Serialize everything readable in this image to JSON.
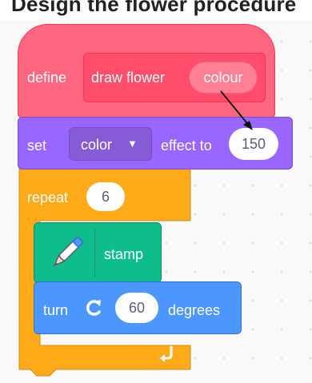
{
  "page_header_text": "Design the flower procedure",
  "define_block": {
    "keyword": "define",
    "procedure_name": "draw flower",
    "parameter": "colour"
  },
  "set_effect_block": {
    "keyword": "set",
    "effect": "color",
    "label": "effect to",
    "value": "150"
  },
  "repeat_block": {
    "keyword": "repeat",
    "count": "6"
  },
  "stamp_block": {
    "icon": "pen-icon",
    "label": "stamp"
  },
  "turn_block": {
    "keyword": "turn",
    "icon": "rotate-clockwise-icon",
    "value": "60",
    "unit": "degrees"
  },
  "colors": {
    "define_block": "#ff6680",
    "define_prototype": "#ff4d6a",
    "looks_block": "#9966ff",
    "control_block": "#ffab19",
    "pen_block": "#0fbd8c",
    "motion_block": "#4c97ff"
  }
}
